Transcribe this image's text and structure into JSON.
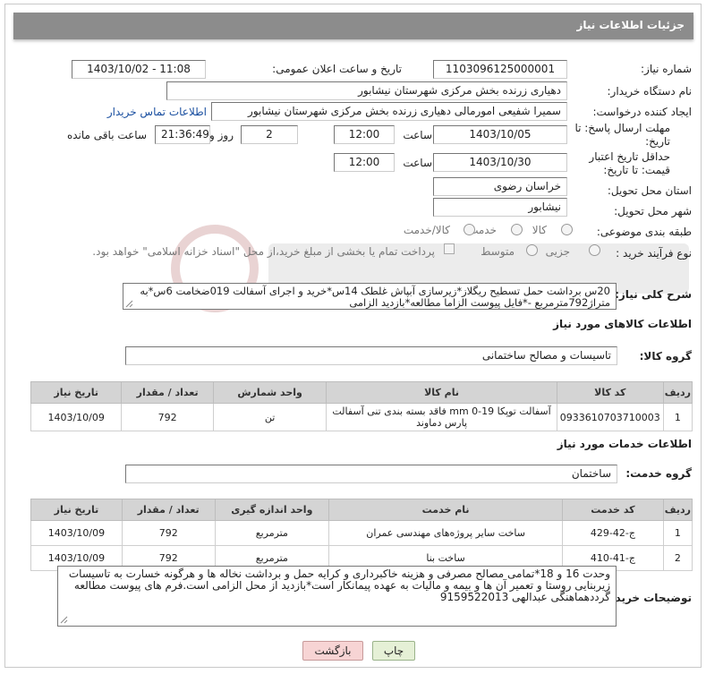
{
  "header": {
    "title": "جزئیات اطلاعات نیاز"
  },
  "form": {
    "need_number_label": "شماره نیاز:",
    "need_number": "1103096125000001",
    "announce_label": "تاریخ و ساعت اعلان عمومی:",
    "announce_value": "1403/10/02 - 11:08",
    "buyer_org_label": "نام دستگاه خریدار:",
    "buyer_org": "دهیاری زرنده بخش مرکزی شهرستان نیشابور",
    "requester_label": "ایجاد کننده درخواست:",
    "requester": "سمیرا شفیعی امورمالی دهیاری زرنده بخش مرکزی شهرستان نیشابور",
    "contact_link": "اطلاعات تماس خریدار",
    "reply_deadline_label": "مهلت ارسال پاسخ: تا تاریخ:",
    "reply_date": "1403/10/05",
    "time_label": "ساعت",
    "reply_time": "12:00",
    "days_value": "2",
    "days_label": "روز و",
    "remaining_time": "21:36:49",
    "remaining_label": "ساعت باقی مانده",
    "price_validity_label": "حداقل تاریخ اعتبار قیمت: تا تاریخ:",
    "price_date": "1403/10/30",
    "price_time": "12:00",
    "province_label": "استان محل تحویل:",
    "province": "خراسان رضوی",
    "city_label": "شهر محل تحویل:",
    "city": "نیشابور",
    "category_label": "طبقه بندی موضوعی:",
    "category_options": [
      "کالا",
      "خدمت",
      "کالا/خدمت"
    ],
    "process_label": "نوع فرآیند خرید :",
    "process_options": [
      "جزیی",
      "متوسط"
    ],
    "payment_note": "پرداخت تمام یا بخشی از مبلغ خرید،از محل \"اسناد خزانه اسلامی\" خواهد بود.",
    "description_label": "شرح کلی نیاز:",
    "description": "20س برداشت حمل تسطیح ریگلاز*زیرسازی آبپاش غلطک 14س*خرید و اجرای آسفالت 019ضخامت 6س*به متراژ792مترمربع -*فایل پیوست الزاما مطالعه*بازدید الزامی"
  },
  "goods": {
    "section_title": "اطلاعات کالاهای مورد نیاز",
    "group_label": "گروه کالا:",
    "group_value": "تاسیسات و مصالح ساختمانی",
    "columns": [
      "ردیف",
      "کد کالا",
      "نام کالا",
      "واحد شمارش",
      "تعداد / مقدار",
      "تاریخ نیاز"
    ],
    "rows": [
      {
        "idx": "1",
        "code": "0933610703710003",
        "name": "آسفالت توپکا mm 0-19 فاقد بسته بندی تنی آسفالت پارس دماوند",
        "unit": "تن",
        "qty": "792",
        "date": "1403/10/09"
      }
    ]
  },
  "services": {
    "section_title": "اطلاعات خدمات مورد نیاز",
    "group_label": "گروه خدمت:",
    "group_value": "ساختمان",
    "columns": [
      "ردیف",
      "کد خدمت",
      "نام خدمت",
      "واحد اندازه گیری",
      "تعداد / مقدار",
      "تاریخ نیاز"
    ],
    "rows": [
      {
        "idx": "1",
        "code": "ج-42-429",
        "name": "ساخت سایر پروژه‌های مهندسی عمران",
        "unit": "مترمربع",
        "qty": "792",
        "date": "1403/10/09"
      },
      {
        "idx": "2",
        "code": "ج-41-410",
        "name": "ساخت بنا",
        "unit": "مترمربع",
        "qty": "792",
        "date": "1403/10/09"
      }
    ]
  },
  "buyer_notes": {
    "label": "توضیحات خریدار:",
    "text": "وحدت 16 و 18*تمامی مصالح مصرفی و  هزینه خاکبرداری و کرایه حمل و برداشت نخاله ها و هرگونه خسارت به تاسیسات زیربنایی روستا و تعمیر آن ها و بیمه و مالیات به عهده پیمانکار است*بازدید از محل الزامی است.فرم های پیوست مطالعه گرددهماهنگی عبدالهی 9159522013"
  },
  "buttons": {
    "print": "چاپ",
    "back": "بازگشت"
  },
  "colors": {
    "title_bar": "#8c8c8c",
    "link": "#1a4fa0",
    "back_button": "#f7d4d4",
    "print_button": "#e5f0d6",
    "table_header": "#d4d4d4"
  }
}
